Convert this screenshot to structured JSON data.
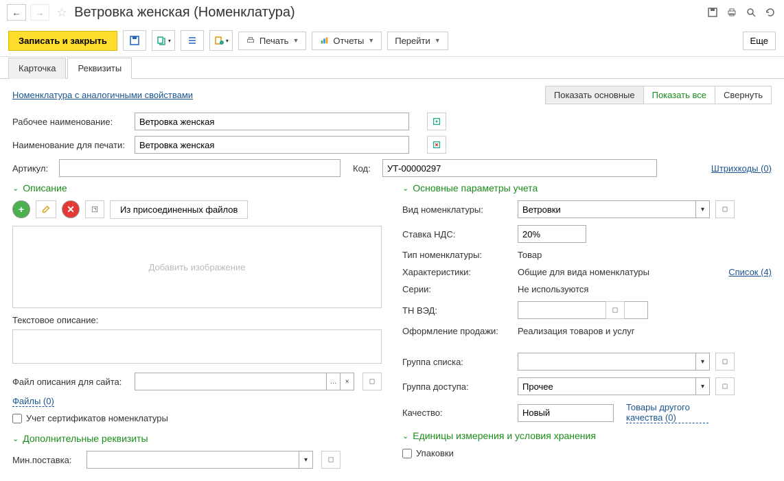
{
  "header": {
    "title": "Ветровка женская (Номенклатура)"
  },
  "toolbar": {
    "save_close": "Записать и закрыть",
    "print": "Печать",
    "reports": "Отчеты",
    "goto": "Перейти",
    "more": "Еще"
  },
  "tabs": {
    "card": "Карточка",
    "requisites": "Реквизиты"
  },
  "topLinks": {
    "analog": "Номенклатура с аналогичными свойствами",
    "show_main": "Показать основные",
    "show_all": "Показать все",
    "collapse": "Свернуть"
  },
  "fields": {
    "work_name_label": "Рабочее наименование:",
    "work_name_value": "Ветровка женская",
    "print_name_label": "Наименование для печати:",
    "print_name_value": "Ветровка женская",
    "article_label": "Артикул:",
    "article_value": "",
    "code_label": "Код:",
    "code_value": "УТ-00000297",
    "barcodes_link": "Штрихкоды (0)"
  },
  "description": {
    "title": "Описание",
    "from_files": "Из присоединенных файлов",
    "add_image": "Добавить изображение",
    "text_desc_label": "Текстовое описание:",
    "file_desc_label": "Файл описания для сайта:",
    "files_link": "Файлы (0)",
    "cert_label": "Учет сертификатов номенклатуры"
  },
  "params": {
    "title": "Основные параметры учета",
    "type_label": "Вид номенклатуры:",
    "type_value": "Ветровки",
    "vat_label": "Ставка НДС:",
    "vat_value": "20%",
    "nom_type_label": "Тип номенклатуры:",
    "nom_type_value": "Товар",
    "char_label": "Характеристики:",
    "char_value": "Общие для вида номенклатуры",
    "char_link": "Список (4)",
    "series_label": "Серии:",
    "series_value": "Не используются",
    "tnved_label": "ТН ВЭД:",
    "sale_label": "Оформление продажи:",
    "sale_value": "Реализация товаров и услуг",
    "list_group_label": "Группа списка:",
    "access_group_label": "Группа доступа:",
    "access_group_value": "Прочее",
    "quality_label": "Качество:",
    "quality_value": "Новый",
    "quality_link": "Товары другого качества (0)"
  },
  "additional": {
    "title": "Дополнительные реквизиты",
    "min_supply_label": "Мин.поставка:"
  },
  "units": {
    "title": "Единицы измерения и условия хранения",
    "packaging_label": "Упаковки"
  }
}
